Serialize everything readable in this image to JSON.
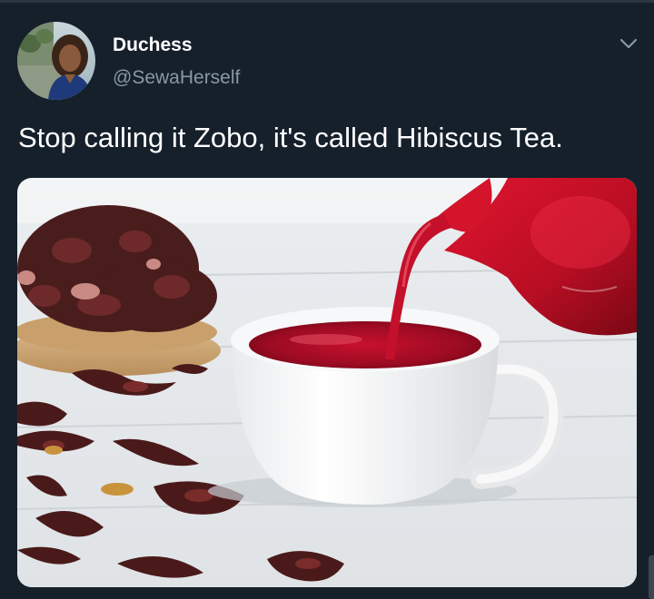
{
  "tweet": {
    "author": {
      "display_name": "Duchess",
      "handle": "@SewaHerself"
    },
    "text": "Stop calling it Zobo, it's called Hibiscus Tea.",
    "icons": {
      "menu": "chevron-down-icon",
      "avatar": "profile-photo"
    },
    "media": {
      "subject": "hibiscus-tea-photo"
    }
  },
  "theme": {
    "background": "#15202b",
    "text_primary": "#ffffff",
    "text_secondary": "#8899a6",
    "divider": "#2a3640"
  }
}
